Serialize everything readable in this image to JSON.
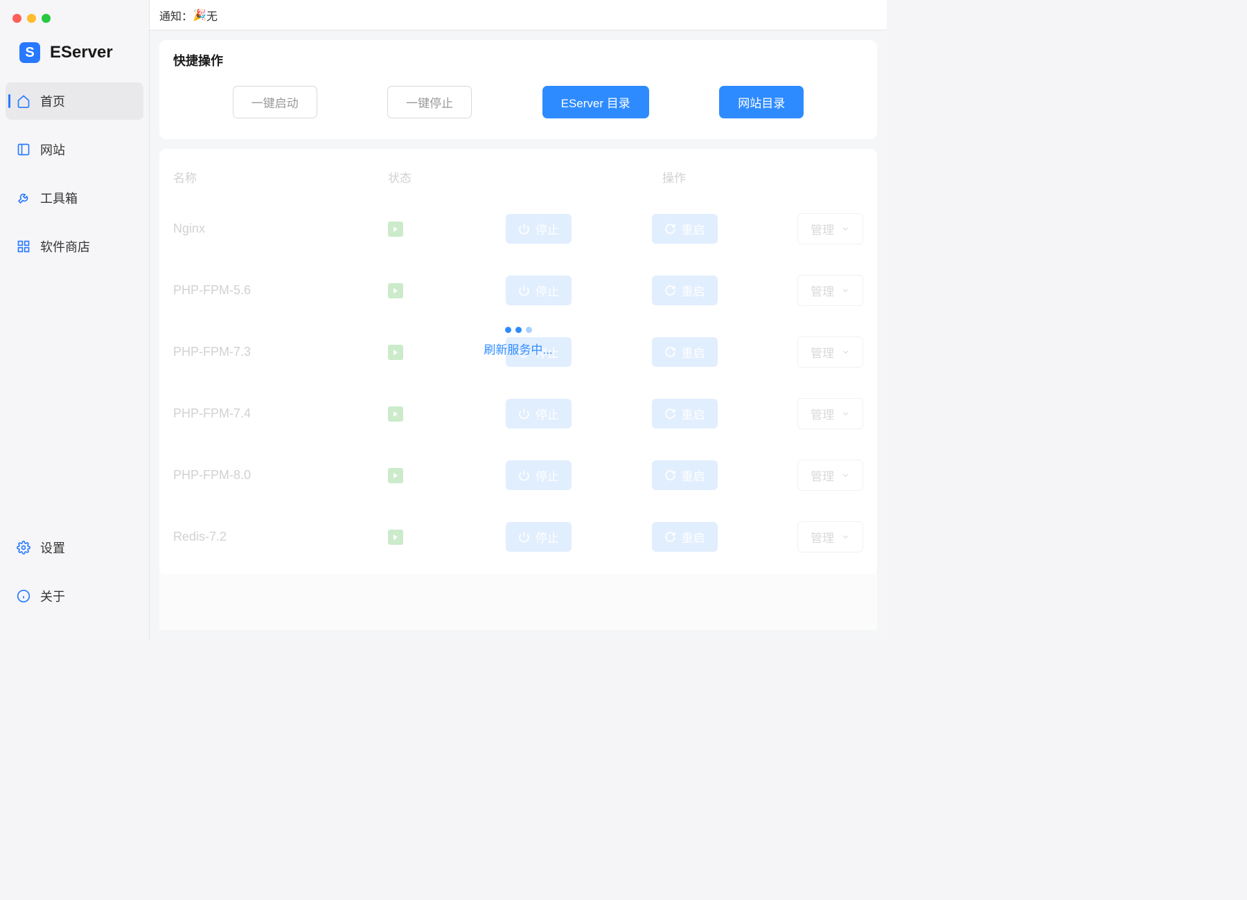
{
  "app": {
    "name": "EServer"
  },
  "topbar": {
    "notice_label": "通知：",
    "notice_text": "无"
  },
  "sidebar": {
    "items": [
      {
        "label": "首页",
        "icon": "home-icon",
        "active": true
      },
      {
        "label": "网站",
        "icon": "sites-icon",
        "active": false
      },
      {
        "label": "工具箱",
        "icon": "toolbox-icon",
        "active": false
      },
      {
        "label": "软件商店",
        "icon": "store-icon",
        "active": false
      }
    ],
    "bottom": [
      {
        "label": "设置",
        "icon": "settings-icon"
      },
      {
        "label": "关于",
        "icon": "about-icon"
      }
    ]
  },
  "quick": {
    "title": "快捷操作",
    "start_all": "一键启动",
    "stop_all": "一键停止",
    "eserver_dir": "EServer 目录",
    "site_dir": "网站目录"
  },
  "table": {
    "headers": {
      "name": "名称",
      "status": "状态",
      "actions": "操作"
    },
    "stop_label": "停止",
    "restart_label": "重启",
    "manage_label": "管理",
    "rows": [
      {
        "name": "Nginx"
      },
      {
        "name": "PHP-FPM-5.6"
      },
      {
        "name": "PHP-FPM-7.3"
      },
      {
        "name": "PHP-FPM-7.4"
      },
      {
        "name": "PHP-FPM-8.0"
      },
      {
        "name": "Redis-7.2"
      }
    ]
  },
  "loading": {
    "text": "刷新服务中..."
  },
  "colors": {
    "primary": "#2e8bff",
    "running": "#8dd28d"
  }
}
